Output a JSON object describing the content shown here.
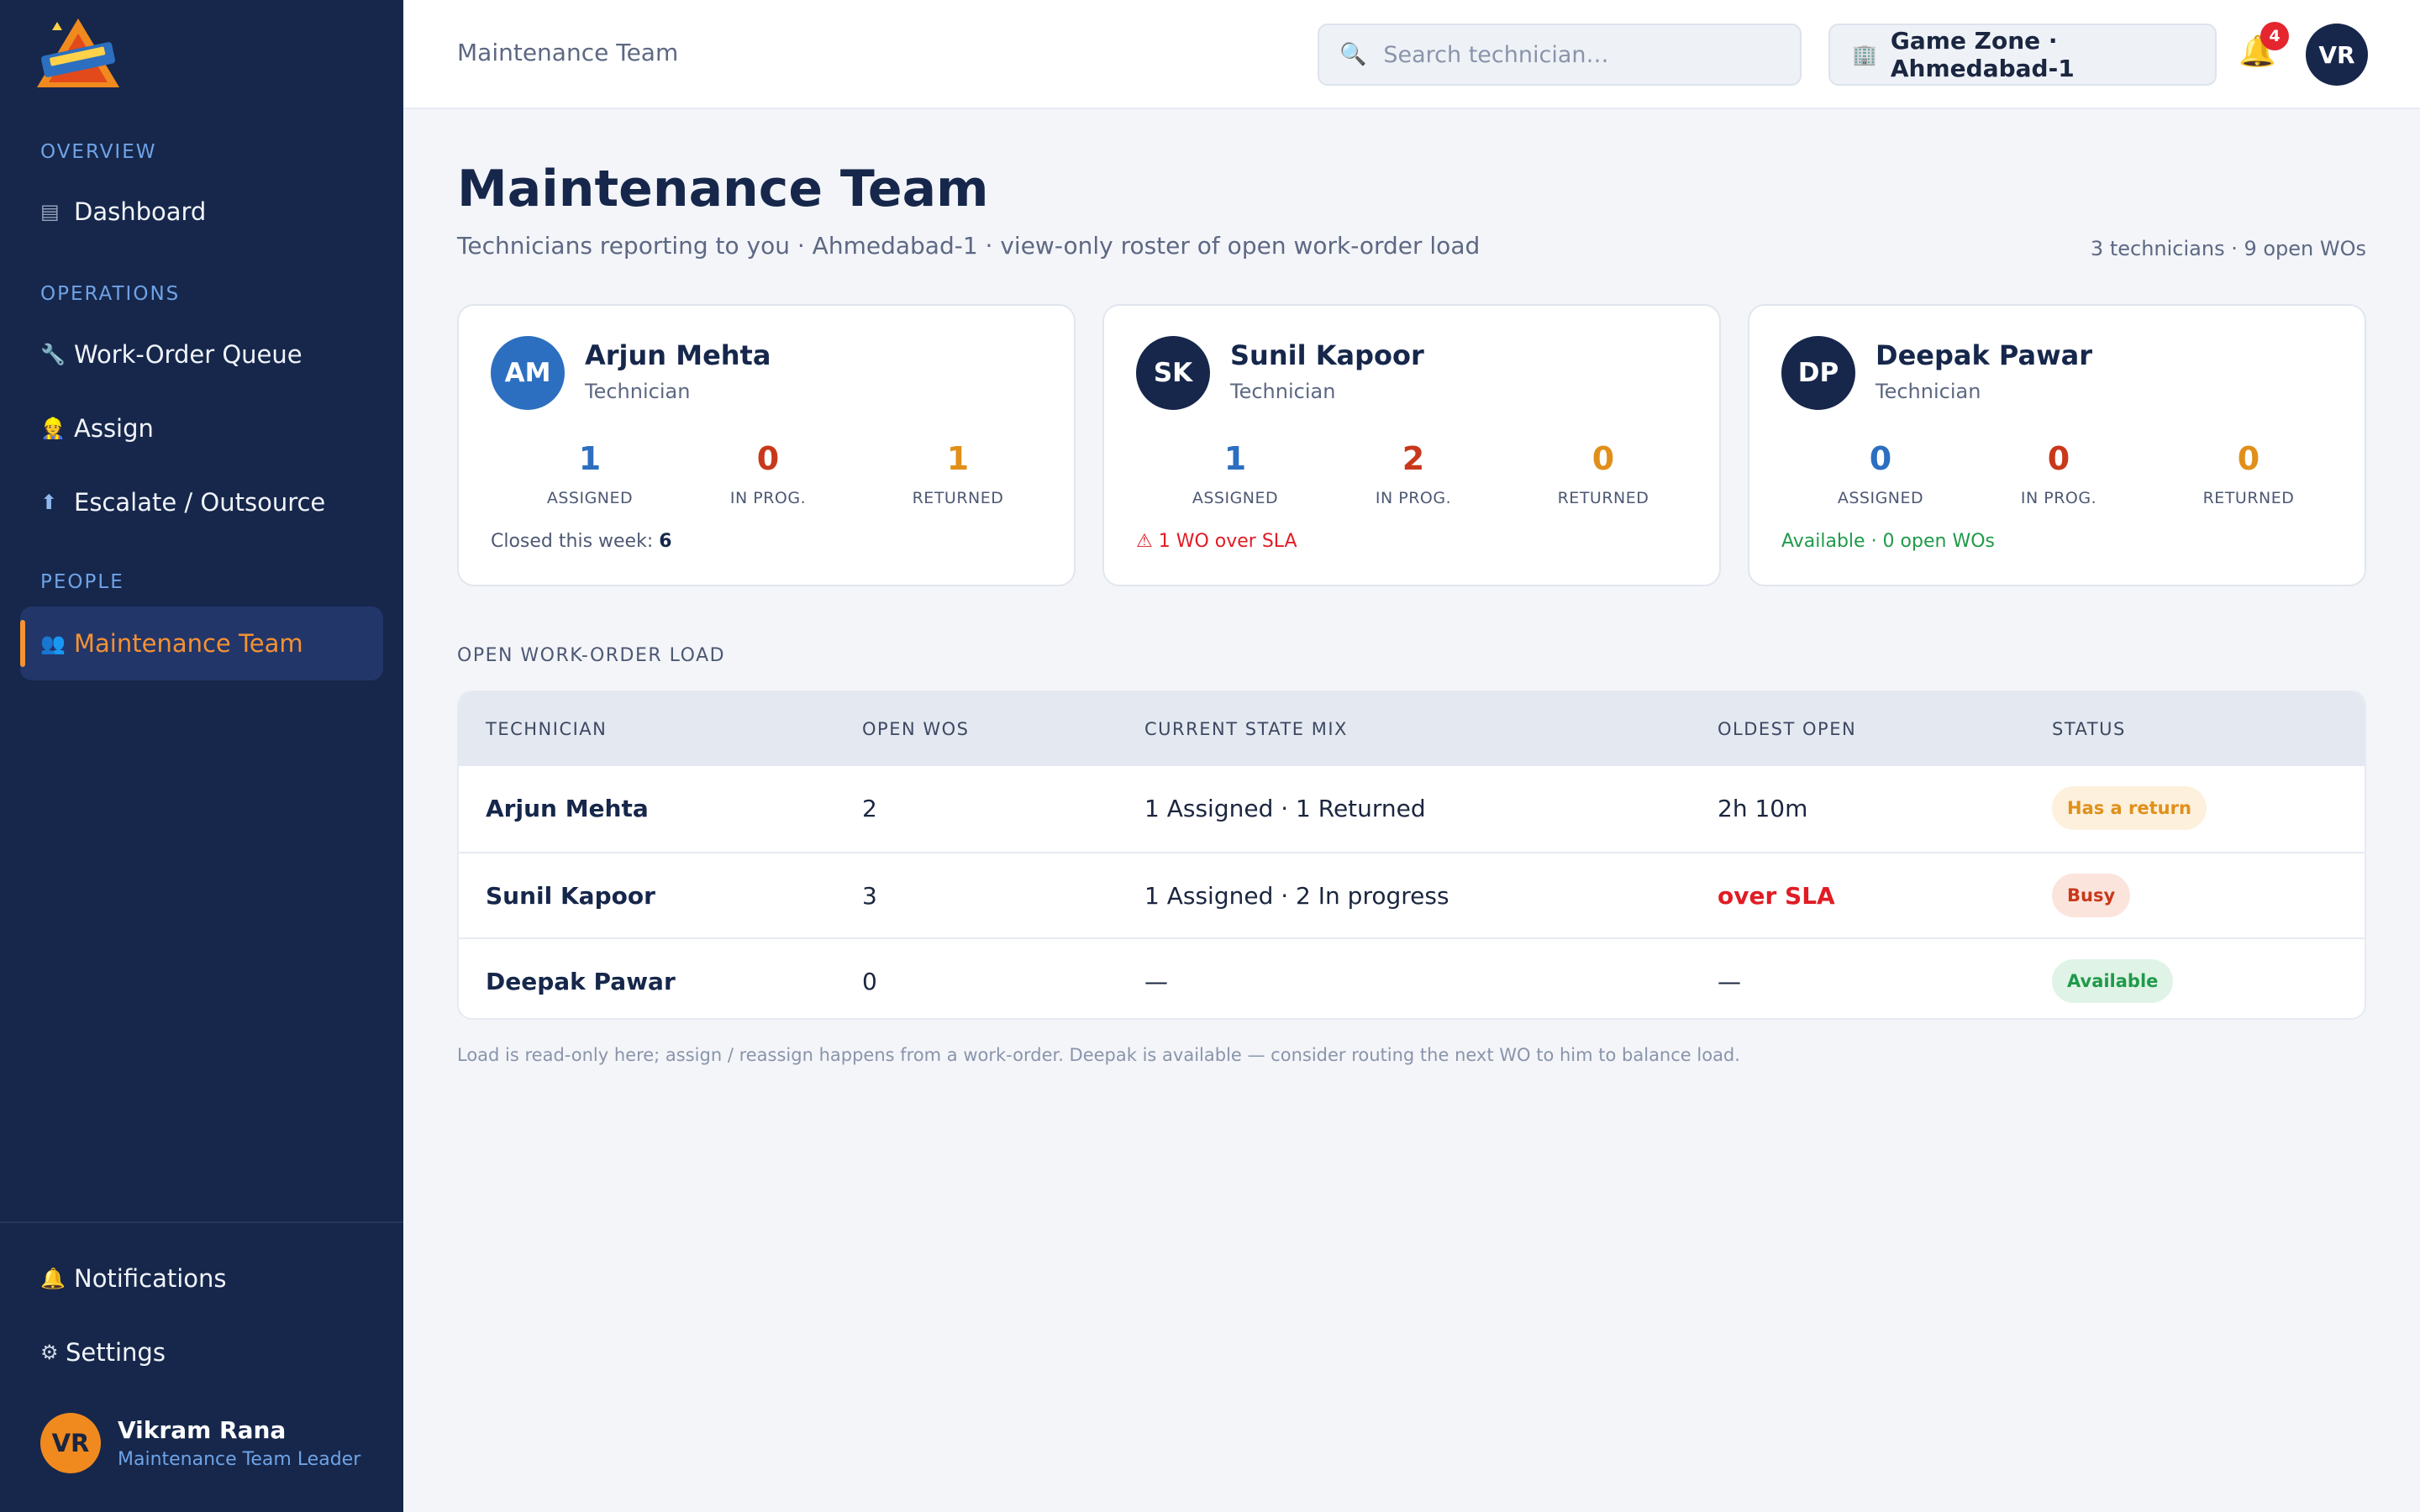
{
  "sidebar": {
    "sections": {
      "overview": "OVERVIEW",
      "operations": "OPERATIONS",
      "people": "PEOPLE"
    },
    "items": {
      "dashboard": {
        "label": "Dashboard",
        "icon": "▤"
      },
      "queue": {
        "label": "Work-Order Queue",
        "icon": "🔧"
      },
      "assign": {
        "label": "Assign",
        "icon": "👷"
      },
      "escalate": {
        "label": "Escalate / Outsource",
        "icon": "⬆"
      },
      "team": {
        "label": "Maintenance Team",
        "icon": "👥"
      },
      "notifications": {
        "label": "Notifications",
        "icon": "🔔"
      },
      "settings": {
        "label": "Settings",
        "icon": "⚙"
      }
    },
    "user": {
      "initials": "VR",
      "name": "Vikram Rana",
      "role": "Maintenance Team Leader"
    }
  },
  "topbar": {
    "breadcrumb": "Maintenance Team",
    "search_placeholder": "Search technician…",
    "site": "Game Zone · Ahmedabad-1",
    "notification_count": "4",
    "avatar_initials": "VR"
  },
  "page": {
    "title": "Maintenance Team",
    "subtitle": "Technicians reporting to you · Ahmedabad-1 · view-only roster of open work-order load",
    "summary": "3 technicians · 9 open WOs"
  },
  "cards": [
    {
      "initials": "AM",
      "name": "Arjun Mehta",
      "role": "Technician",
      "assigned": "1",
      "in_progress": "0",
      "returned": "1",
      "assigned_label": "ASSIGNED",
      "in_progress_label": "IN PROG.",
      "returned_label": "RETURNED",
      "note_prefix": "Closed this week: ",
      "note_value": "6"
    },
    {
      "initials": "SK",
      "name": "Sunil Kapoor",
      "role": "Technician",
      "assigned": "1",
      "in_progress": "2",
      "returned": "0",
      "assigned_label": "ASSIGNED",
      "in_progress_label": "IN PROG.",
      "returned_label": "RETURNED",
      "note": "⚠ 1 WO over SLA"
    },
    {
      "initials": "DP",
      "name": "Deepak Pawar",
      "role": "Technician",
      "assigned": "0",
      "in_progress": "0",
      "returned": "0",
      "assigned_label": "ASSIGNED",
      "in_progress_label": "IN PROG.",
      "returned_label": "RETURNED",
      "note": "Available · 0 open WOs"
    }
  ],
  "table": {
    "section_label": "OPEN WORK-ORDER LOAD",
    "headers": [
      "TECHNICIAN",
      "OPEN WOS",
      "CURRENT STATE MIX",
      "OLDEST OPEN",
      "STATUS"
    ],
    "rows": [
      {
        "technician": "Arjun Mehta",
        "open": "2",
        "mix": "1 Assigned · 1 Returned",
        "oldest": "2h 10m",
        "status": "Has a return"
      },
      {
        "technician": "Sunil Kapoor",
        "open": "3",
        "mix": "1 Assigned · 2 In progress",
        "oldest": "over SLA",
        "status": "Busy"
      },
      {
        "technician": "Deepak Pawar",
        "open": "0",
        "mix": "—",
        "oldest": "—",
        "status": "Available"
      }
    ],
    "footnote": "Load is read-only here; assign / reassign happens from a work-order. Deepak is available — consider routing the next WO to him to balance load."
  },
  "colors": {
    "sidebar_bg": "#16274b",
    "accent_orange": "#f59232",
    "assigned_blue": "#2c6fc0",
    "in_progress_red": "#c9381b",
    "returned_amber": "#e0901a",
    "danger": "#e01c24",
    "success": "#1f9a4a"
  }
}
